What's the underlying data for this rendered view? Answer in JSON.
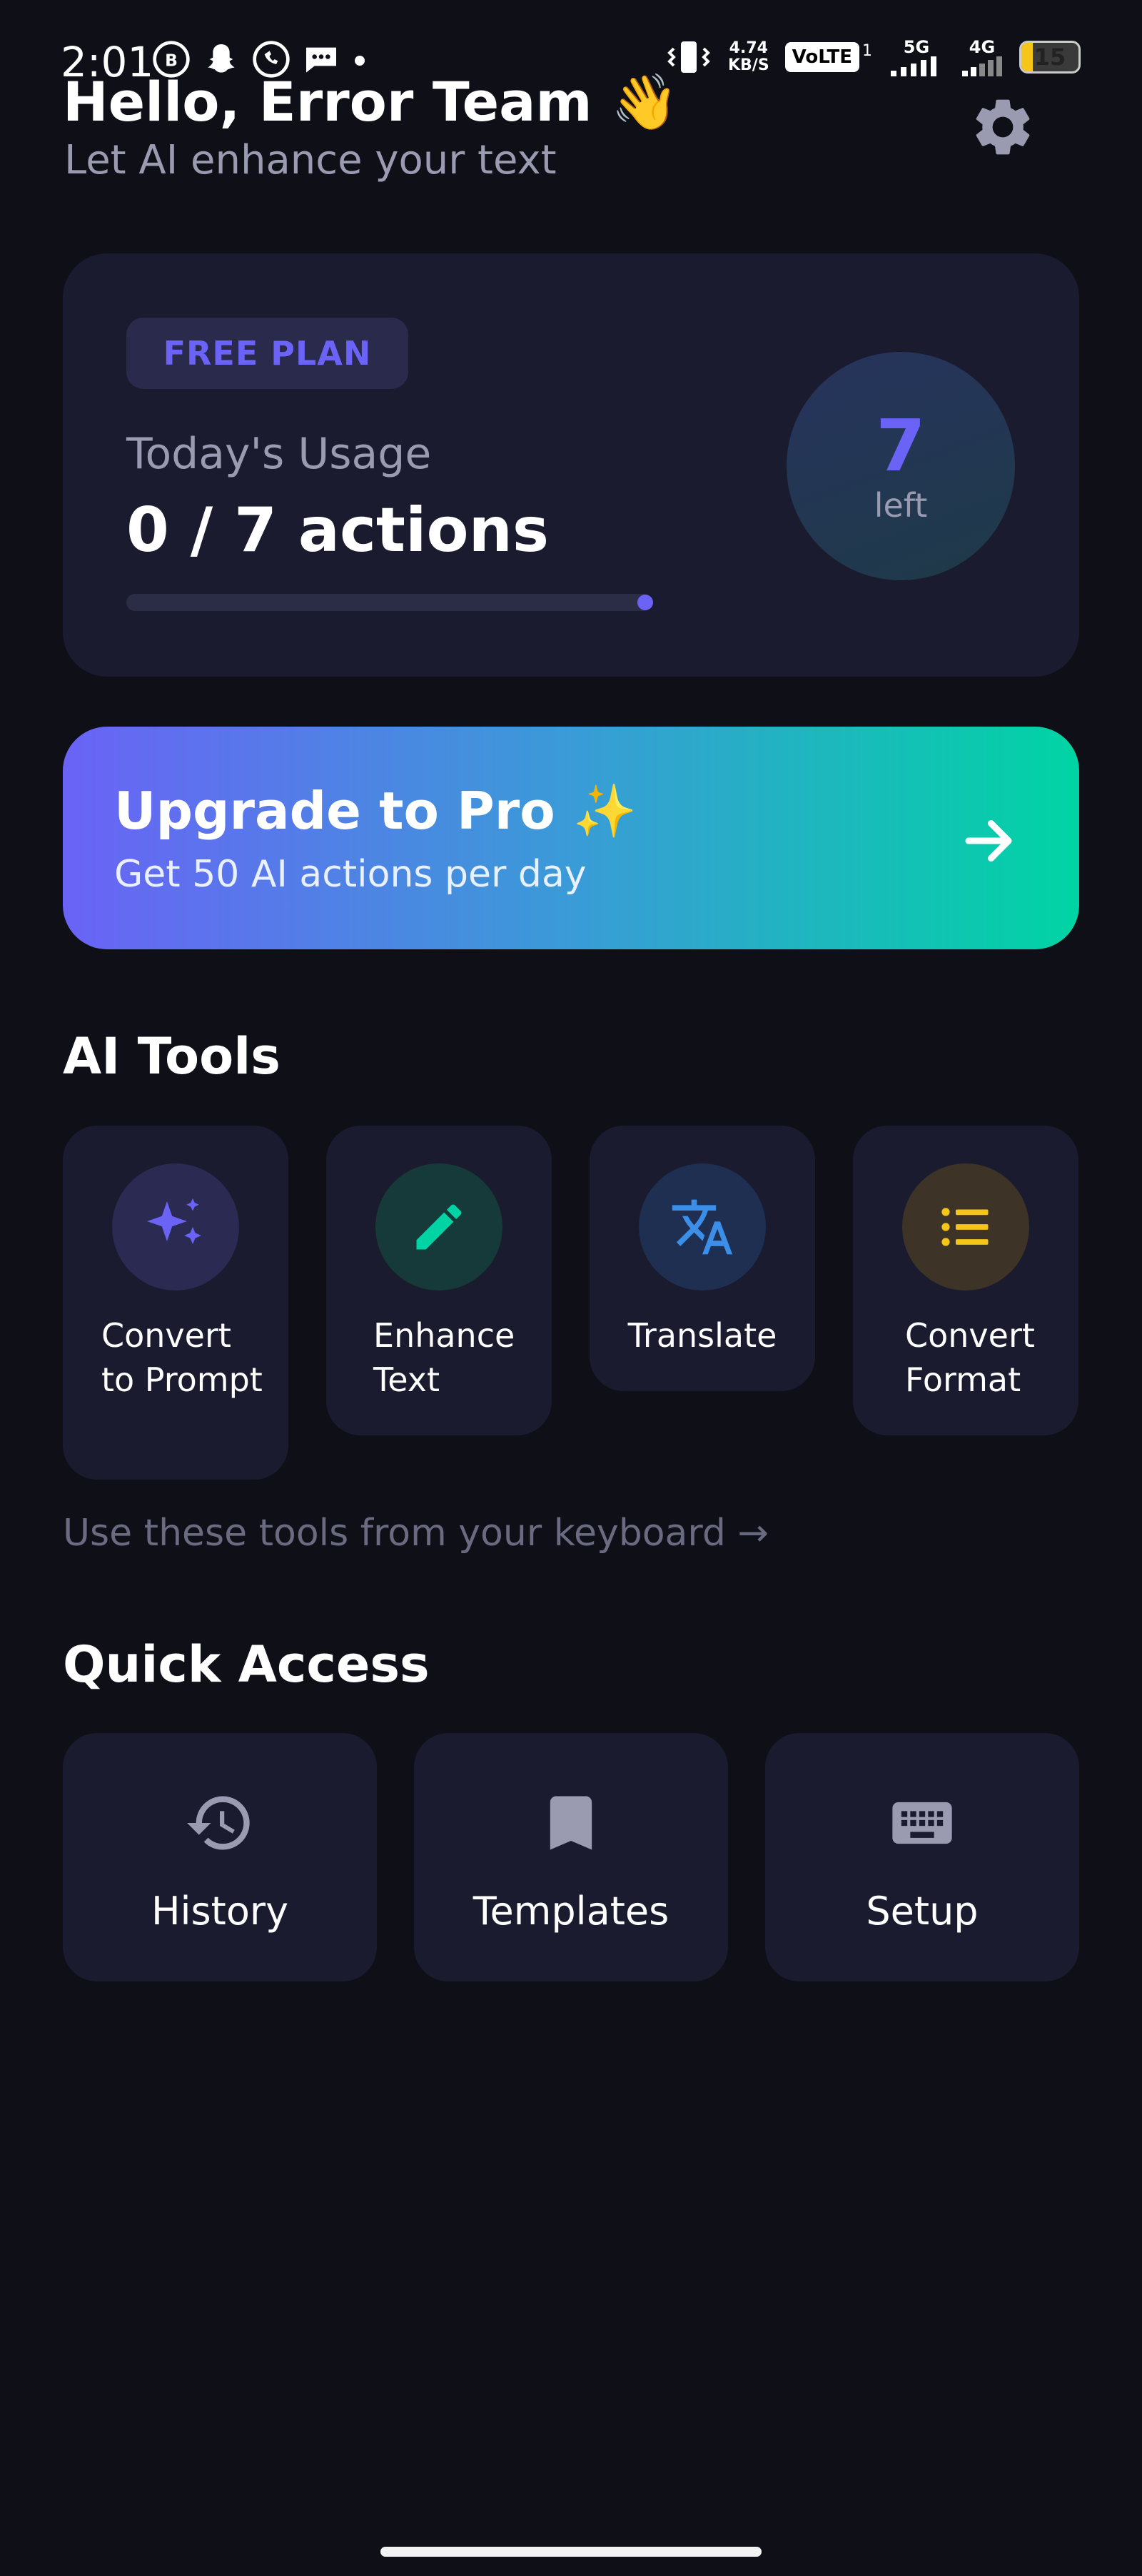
{
  "status_bar": {
    "time": "2:01",
    "net_speed_value": "4.74",
    "net_speed_unit": "KB/S",
    "volte": "VoLTE",
    "volte_sup": "1",
    "sig1": "5G",
    "sig2": "4G",
    "battery": "15",
    "icons_left": [
      "whatsapp-business-icon",
      "snapchat-icon",
      "whatsapp-icon",
      "message-icon",
      "dot-icon"
    ]
  },
  "header": {
    "greeting": "Hello, Error Team 👋",
    "subtitle": "Let AI enhance your text"
  },
  "usage": {
    "plan": "FREE PLAN",
    "label": "Today's Usage",
    "value": "0 / 7 actions",
    "progress_fraction": 0,
    "remaining_count": "7",
    "remaining_label": "left"
  },
  "upgrade": {
    "title": "Upgrade to Pro ✨",
    "subtitle": "Get 50 AI actions per day"
  },
  "ai_tools": {
    "title": "AI Tools",
    "items": [
      {
        "label": "Convert to Prompt",
        "icon": "sparkles-icon",
        "color": "#6a63f6"
      },
      {
        "label": "Enhance Text",
        "icon": "pencil-icon",
        "color": "#00d4a4"
      },
      {
        "label": "Translate",
        "icon": "translate-icon",
        "color": "#3b8fe8"
      },
      {
        "label": "Convert Format",
        "icon": "list-icon",
        "color": "#f5c518"
      }
    ],
    "hint": "Use these tools from your keyboard →"
  },
  "quick_access": {
    "title": "Quick Access",
    "items": [
      {
        "label": "History",
        "icon": "history-icon"
      },
      {
        "label": "Templates",
        "icon": "bookmark-icon"
      },
      {
        "label": "Setup",
        "icon": "keyboard-icon"
      }
    ]
  },
  "colors": {
    "background": "#0e0f17",
    "card": "#1a1b2e",
    "accent": "#6a63f6",
    "teal": "#00d4a4"
  }
}
